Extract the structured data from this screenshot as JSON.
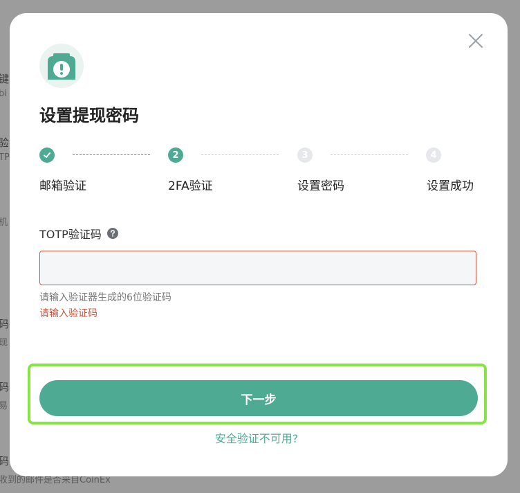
{
  "background": {
    "fragments": [
      {
        "text": "键",
        "sub": "bi"
      },
      {
        "text": "验",
        "sub": "TP"
      },
      {
        "text": "",
        "sub": "机"
      },
      {
        "text": "码",
        "sub": "现"
      },
      {
        "text": "码",
        "sub": "易"
      },
      {
        "text": "码",
        "sub": "收到的邮件是否来自CoinEx"
      }
    ]
  },
  "modal": {
    "title": "设置提现密码",
    "close_icon": "close-icon",
    "badge_icon": "shield-alert-icon",
    "steps": [
      {
        "number": "",
        "label": "邮箱验证",
        "state": "done"
      },
      {
        "number": "2",
        "label": "2FA验证",
        "state": "active"
      },
      {
        "number": "3",
        "label": "设置密码",
        "state": "pending"
      },
      {
        "number": "4",
        "label": "设置成功",
        "state": "pending"
      }
    ],
    "otp": {
      "label": "TOTP验证码",
      "value": "",
      "placeholder": "",
      "hint": "请输入验证器生成的6位验证码",
      "error": "请输入验证码"
    },
    "next_button": "下一步",
    "unavailable_link": "安全验证不可用?"
  },
  "colors": {
    "accent": "#4faa93",
    "error": "#c8553d",
    "highlight": "#86e445"
  }
}
